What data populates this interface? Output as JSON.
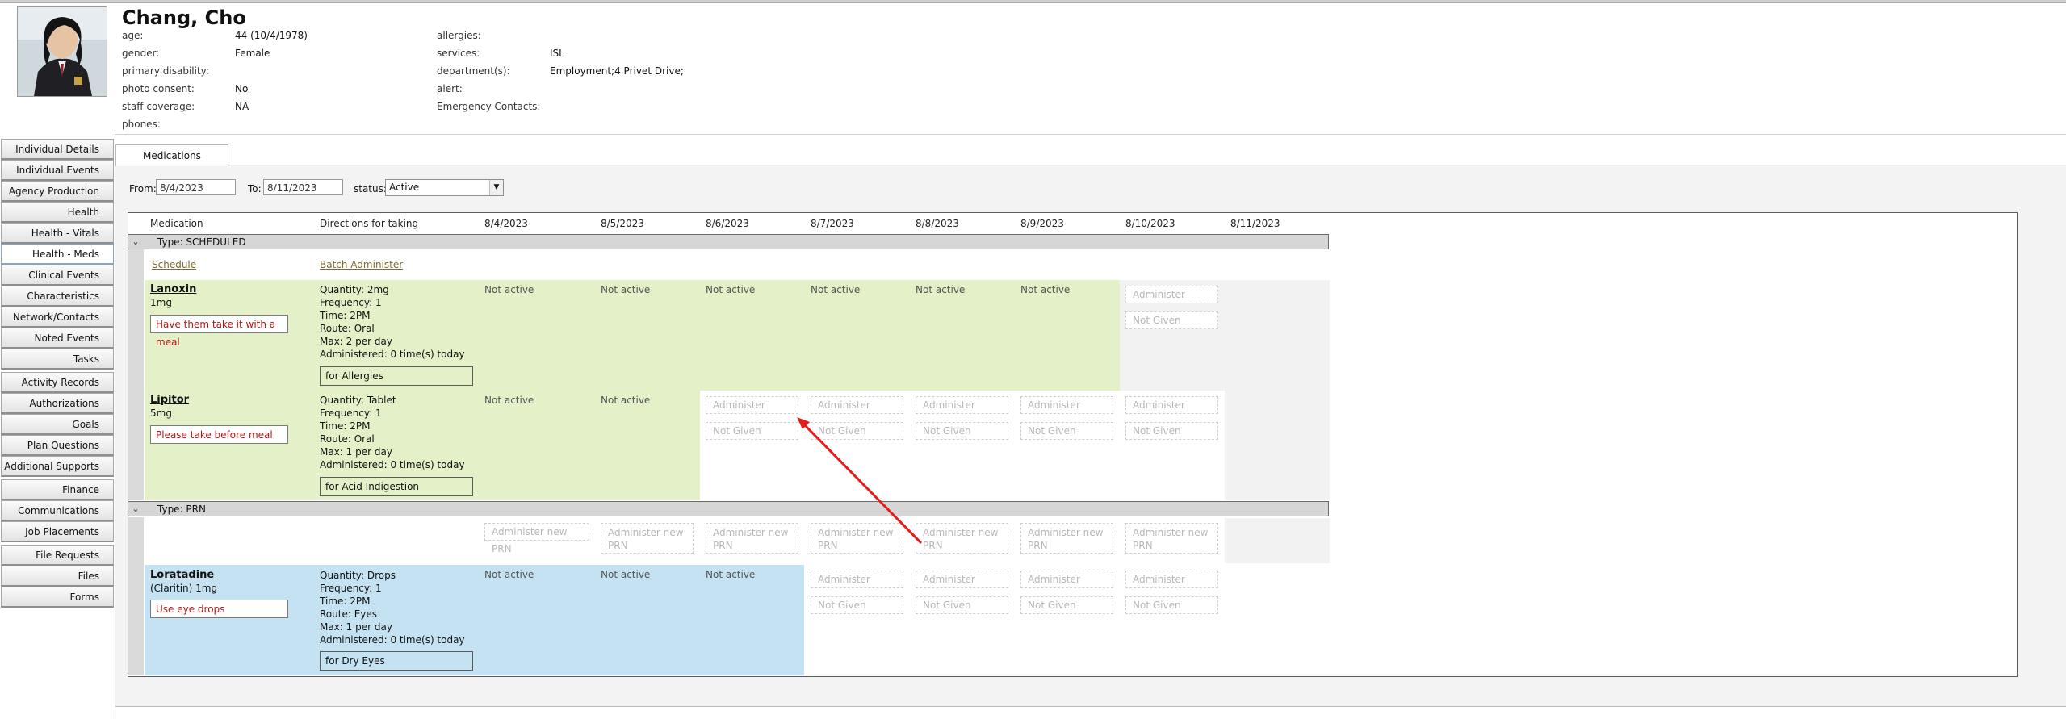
{
  "patient": {
    "name": "Chang, Cho",
    "left": [
      {
        "label": "age:",
        "value": "44 (10/4/1978)"
      },
      {
        "label": "gender:",
        "value": "Female"
      },
      {
        "label": "primary disability:",
        "value": ""
      },
      {
        "label": "photo consent:",
        "value": "No"
      },
      {
        "label": "staff coverage:",
        "value": "NA"
      },
      {
        "label": "phones:",
        "value": ""
      }
    ],
    "right": [
      {
        "label": "allergies:",
        "value": ""
      },
      {
        "label": "services:",
        "value": "ISL"
      },
      {
        "label": "department(s):",
        "value": "Employment;4 Privet Drive;"
      },
      {
        "label": "alert:",
        "value": ""
      },
      {
        "label": "Emergency Contacts:",
        "value": ""
      }
    ]
  },
  "nav": [
    "Individual Details",
    "Individual Events",
    "Agency Production",
    "Health",
    "Health - Vitals",
    "Health - Meds",
    "Clinical Events",
    "Characteristics",
    "Network/Contacts",
    "Noted Events",
    "Tasks",
    "Activity Records",
    "Authorizations",
    "Goals",
    "Plan Questions",
    "Additional Supports",
    "Finance",
    "Communications",
    "Job Placements",
    "File Requests",
    "Files",
    "Forms"
  ],
  "tab": "Medications",
  "filters": {
    "from_label": "From:",
    "from_value": "8/4/2023",
    "to_label": "To:",
    "to_value": "8/11/2023",
    "status_label": "status:",
    "status_value": "Active"
  },
  "columns": {
    "medication": "Medication",
    "directions": "Directions for taking",
    "dates": [
      "8/4/2023",
      "8/5/2023",
      "8/6/2023",
      "8/7/2023",
      "8/8/2023",
      "8/9/2023",
      "8/10/2023",
      "8/11/2023"
    ]
  },
  "groups": {
    "scheduled": "Type: SCHEDULED",
    "prn": "Type: PRN",
    "schedule_link": "Schedule",
    "batch_link": "Batch Administer"
  },
  "labels": {
    "not_active": "Not active",
    "administer": "Administer",
    "not_given": "Not Given",
    "administer_prn": "Administer new PRN",
    "administer_prn_l1": "Administer new",
    "administer_prn_l2": "PRN"
  },
  "meds": {
    "lanoxin": {
      "name": "Lanoxin",
      "dose": "1mg",
      "note": "Have them take it with a meal",
      "directions": [
        "Quantity: 2mg",
        "Frequency: 1",
        "Time: 2PM",
        "Route: Oral",
        "Max: 2 per day",
        "Administered: 0 time(s) today"
      ],
      "for": "for Allergies"
    },
    "lipitor": {
      "name": "Lipitor",
      "dose": "5mg",
      "note": "Please take before meal",
      "directions": [
        "Quantity: Tablet",
        "Frequency: 1",
        "Time: 2PM",
        "Route: Oral",
        "Max: 1 per day",
        "Administered: 0 time(s) today"
      ],
      "for": "for Acid Indigestion"
    },
    "loratadine": {
      "name": "Loratadine",
      "dose": "(Claritin) 1mg",
      "note": "Use eye drops",
      "directions": [
        "Quantity: Drops",
        "Frequency: 1",
        "Time: 2PM",
        "Route: Eyes",
        "Max: 1 per day",
        "Administered: 0 time(s) today"
      ],
      "for": "for Dry Eyes"
    }
  },
  "colors": {
    "scheduled_row": "#e3f0c8",
    "prn_row": "#c5e2f2",
    "note_text": "#b01818",
    "link": "#7b6b2f",
    "arrow": "#e51c1c"
  }
}
